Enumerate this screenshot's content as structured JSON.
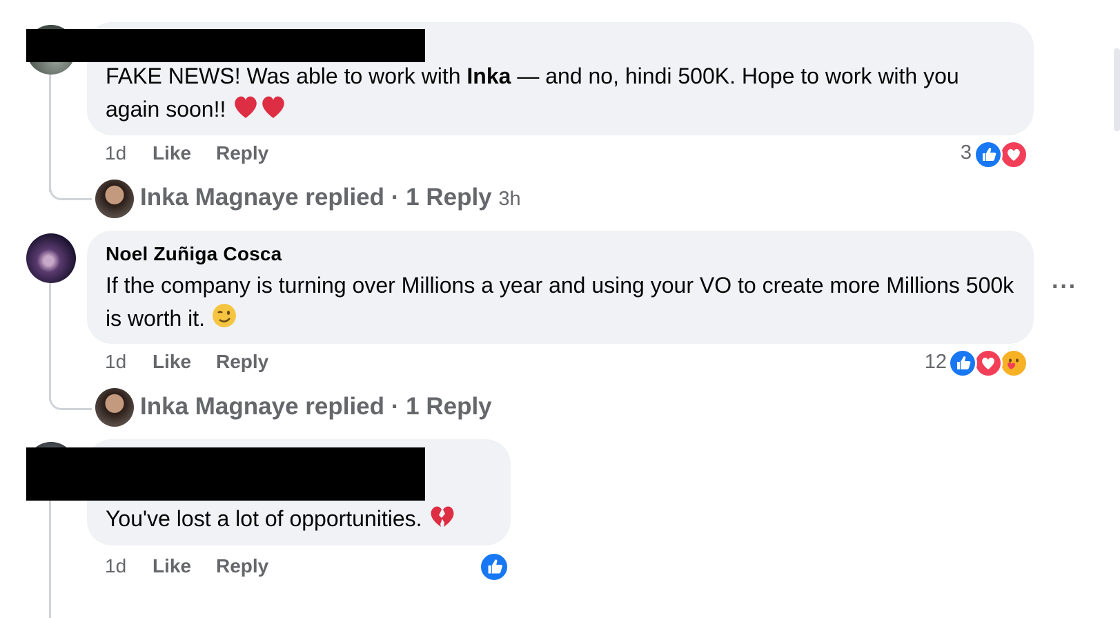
{
  "comments": [
    {
      "author": "",
      "text_prefix": "FAKE NEWS! Was able to work with ",
      "text_bold": "Inka",
      "text_suffix": " — and no, hindi 500K. Hope to work with you again soon!!",
      "time": "1d",
      "like_label": "Like",
      "reply_label": "Reply",
      "reaction_count": "3",
      "reactions": [
        "like-icon",
        "love-icon"
      ],
      "replied_author": "Inka Magnaye replied",
      "replied_sep": " · ",
      "replied_count": "1 Reply",
      "replied_time": "3h"
    },
    {
      "author": "Noel Zuñiga Cosca",
      "text": "If the company is turning over Millions a year and using your VO to create more Millions 500k is worth it.",
      "time": "1d",
      "like_label": "Like",
      "reply_label": "Reply",
      "reaction_count": "12",
      "reactions": [
        "like-icon",
        "love-icon",
        "care-icon"
      ],
      "replied_author": "Inka Magnaye replied",
      "replied_sep": " · ",
      "replied_count": "1 Reply",
      "more_options": "···"
    },
    {
      "author": "",
      "text": "You've lost a lot of opportunities.",
      "time": "1d",
      "like_label": "Like",
      "reply_label": "Reply",
      "reactions": [
        "like-icon"
      ]
    }
  ],
  "colors": {
    "bubble": "#f0f2f5",
    "meta": "#65676b",
    "like_blue": "#1877f2",
    "love_red": "#f33e58"
  }
}
